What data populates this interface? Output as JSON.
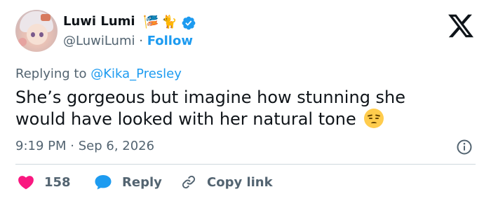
{
  "author": {
    "display_name": "Luwi Lumi",
    "name_emojis": [
      "🎏",
      "🐈"
    ],
    "handle": "@LuwiLumi",
    "separator": "·",
    "follow_label": "Follow"
  },
  "reply_context": {
    "prefix": "Replying to",
    "mention": "@Kika_Presley"
  },
  "tweet": {
    "text": "She’s gorgeous but imagine how stunning she would have looked with her natural tone",
    "trailing_emoji": "disappointed-face"
  },
  "meta": {
    "time": "9:19 PM",
    "separator": "·",
    "date": "Sep 6, 2026"
  },
  "actions": {
    "like_count": "158",
    "reply_label": "Reply",
    "copy_label": "Copy link"
  },
  "colors": {
    "accent": "#1d9bf0",
    "like": "#f91880",
    "text": "#0f1419",
    "secondary": "#536471",
    "divider": "#cfd9de"
  }
}
